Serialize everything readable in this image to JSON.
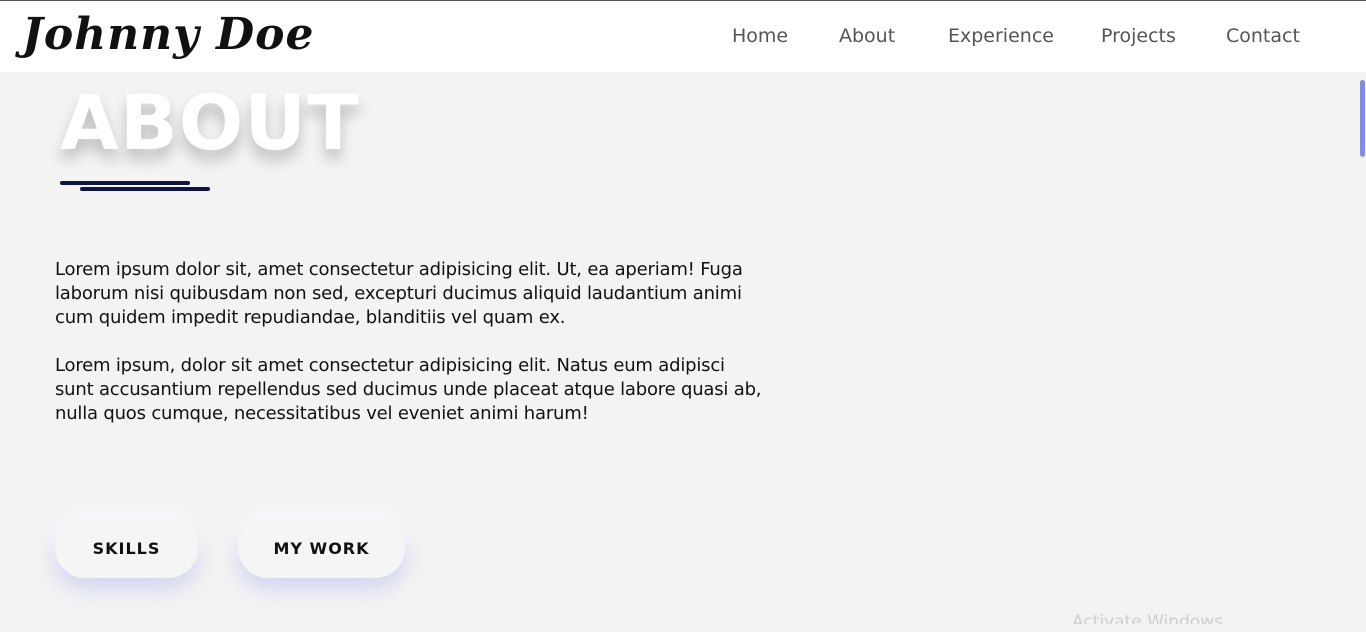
{
  "nav": {
    "logo": "Johnny Doe",
    "items": [
      "Home",
      "About",
      "Experience",
      "Projects",
      "Contact"
    ]
  },
  "about": {
    "title": "ABOUT",
    "paragraphs": [
      "Lorem ipsum dolor sit, amet consectetur adipisicing elit. Ut, ea aperiam! Fuga laborum nisi quibusdam non sed, excepturi ducimus aliquid laudantium animi cum quidem impedit repudiandae, blanditiis vel quam ex.",
      "Lorem ipsum, dolor sit amet consectetur adipisicing elit. Natus eum adipisci sunt accusantium repellendus sed ducimus unde placeat atque labore quasi ab, nulla quos cumque, necessitatibus vel eveniet animi harum!"
    ],
    "buttons": {
      "skills": "SKILLS",
      "my_work": "MY WORK"
    },
    "peek_text": "Activate Windows"
  },
  "colors": {
    "accent_dark": "#0d1440",
    "scroll_thumb": "#7f8ce8",
    "background": "#f3f3f3"
  }
}
